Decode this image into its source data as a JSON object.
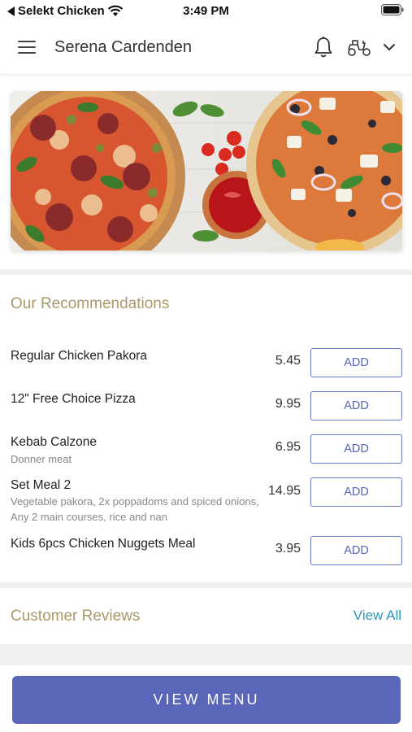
{
  "status_bar": {
    "carrier": "Selekt Chicken",
    "time": "3:49 PM"
  },
  "header": {
    "title": "Serena Cardenden",
    "menu_icon": "hamburger-menu-icon",
    "notification_icon": "bell-icon",
    "delivery_icon": "scooter-icon",
    "dropdown_icon": "chevron-down-icon"
  },
  "recommendations": {
    "title": "Our Recommendations",
    "add_label": "ADD",
    "items": [
      {
        "name": "Regular Chicken Pakora",
        "description": "",
        "price": "5.45"
      },
      {
        "name": "12\" Free Choice Pizza",
        "description": "",
        "price": "9.95"
      },
      {
        "name": "Kebab Calzone",
        "description": "Donner meat",
        "price": "6.95"
      },
      {
        "name": "Set Meal 2",
        "description": "Vegetable pakora, 2x poppadoms and spiced onions, Any 2 main courses, rice and nan",
        "price": "14.95"
      },
      {
        "name": "Kids 6pcs Chicken Nuggets Meal",
        "description": "",
        "price": "3.95"
      }
    ]
  },
  "reviews": {
    "title": "Customer Reviews",
    "view_all_label": "View All"
  },
  "footer": {
    "view_menu_label": "VIEW MENU"
  },
  "colors": {
    "accent_gold": "#a79a6b",
    "primary_blue": "#5a66b8",
    "link_teal": "#2b97b9"
  }
}
